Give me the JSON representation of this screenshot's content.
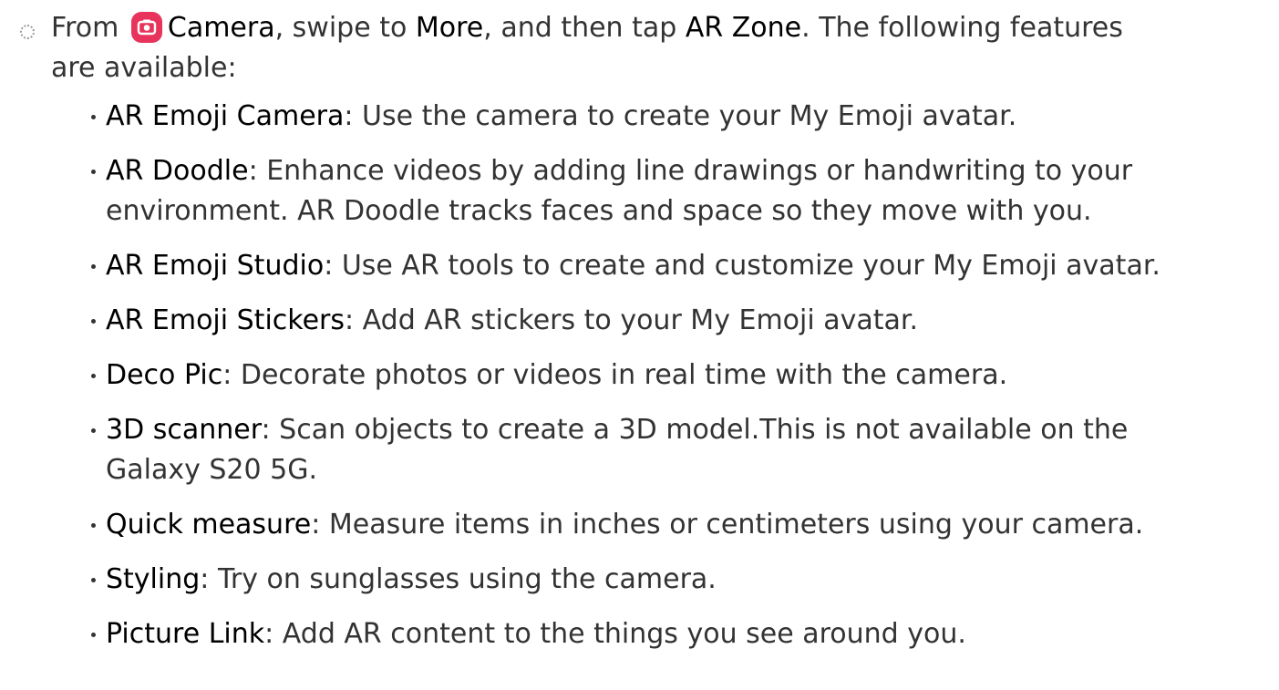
{
  "intro": {
    "from": "From",
    "camera": "Camera",
    "swipe": ", swipe to",
    "more": "More",
    "then": ", and then tap",
    "ar_zone": "AR Zone",
    "following_1": ". The following features",
    "following_2": "are available:"
  },
  "icons": {
    "camera_app": "camera-app-icon",
    "step": "step-circle-icon",
    "accent": "#e8345c"
  },
  "features": [
    {
      "term": "AR Emoji Camera",
      "sep": ":",
      "desc": " Use the camera to create your My Emoji avatar."
    },
    {
      "term": "AR Doodle",
      "sep": ":",
      "desc": " Enhance videos by adding line drawings or handwriting to your environment. AR Doodle tracks faces and space so they move with you."
    },
    {
      "term": "AR Emoji Studio",
      "sep": ":",
      "desc": " Use AR tools to create and customize your My Emoji avatar."
    },
    {
      "term": "AR Emoji Stickers",
      "sep": ":",
      "desc": " Add AR stickers to your My Emoji avatar."
    },
    {
      "term": "Deco Pic",
      "sep": ":",
      "desc": " Decorate photos or videos in real time with the camera."
    },
    {
      "term": "3D scanner",
      "sep": ":",
      "desc": " Scan objects to create a 3D model.This is not available on the Galaxy S20 5G."
    },
    {
      "term": "Quick measure",
      "sep": ":",
      "desc": " Measure items in inches or centimeters using your camera."
    },
    {
      "term": "Styling",
      "sep": ":",
      "desc": " Try on sunglasses using the camera."
    },
    {
      "term": "Picture Link",
      "sep": ":",
      "desc": " Add AR content to the things you see around you."
    }
  ]
}
